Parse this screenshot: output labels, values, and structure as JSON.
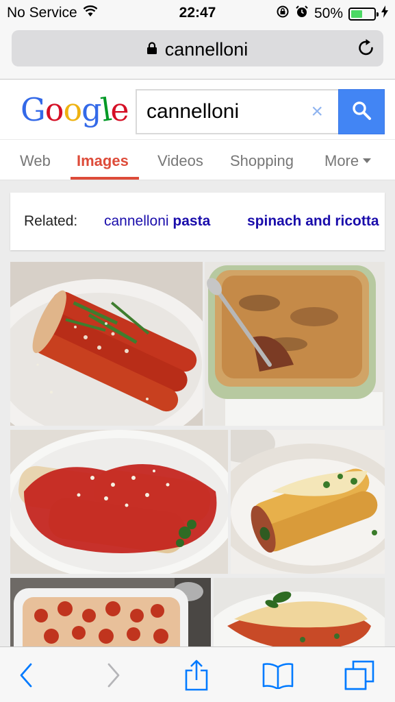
{
  "status_bar": {
    "carrier": "No Service",
    "time": "22:47",
    "battery_percent": "50%",
    "battery_level": 0.5
  },
  "browser": {
    "url": "cannelloni"
  },
  "google": {
    "logo_letters": [
      {
        "ch": "G",
        "color": "#3369e8"
      },
      {
        "ch": "o",
        "color": "#d50f25"
      },
      {
        "ch": "o",
        "color": "#eeb211"
      },
      {
        "ch": "g",
        "color": "#3369e8"
      },
      {
        "ch": "l",
        "color": "#009925"
      },
      {
        "ch": "e",
        "color": "#d50f25"
      }
    ],
    "search_value": "cannelloni",
    "clear_symbol": "×"
  },
  "tabs": [
    "Web",
    "Images",
    "Videos",
    "Shopping",
    "More"
  ],
  "active_tab": "Images",
  "related": {
    "label": "Related:",
    "items": [
      {
        "prefix": "cannelloni ",
        "bold": "pasta"
      },
      {
        "prefix": "",
        "bold": "spinach and ricotta"
      }
    ]
  },
  "colors": {
    "accent": "#dd4b39",
    "search_button": "#4285f4",
    "link": "#1a0dab",
    "ios_blue": "#007aff"
  },
  "toolbar_icons": [
    "back-icon",
    "forward-icon",
    "share-icon",
    "bookmarks-icon",
    "tabs-icon"
  ]
}
